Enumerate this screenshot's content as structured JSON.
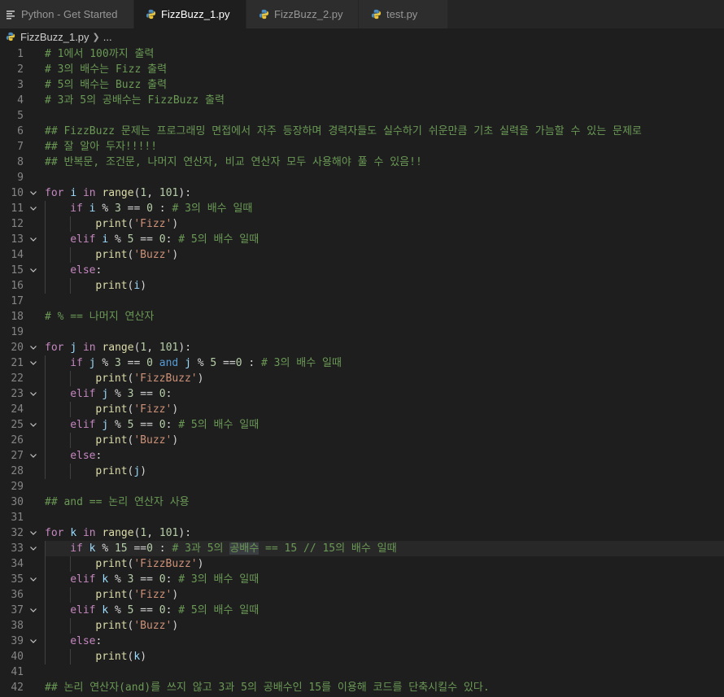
{
  "tabs": [
    {
      "label": "Python - Get Started",
      "icon": "preview-icon",
      "active": false,
      "modified": false
    },
    {
      "label": "FizzBuzz_1.py",
      "icon": "python-icon",
      "active": true,
      "modified": true
    },
    {
      "label": "FizzBuzz_2.py",
      "icon": "python-icon",
      "active": false,
      "modified": false
    },
    {
      "label": "test.py",
      "icon": "python-icon",
      "active": false,
      "modified": false
    }
  ],
  "breadcrumb": {
    "file": "FizzBuzz_1.py",
    "more": "..."
  },
  "colors": {
    "comment": "#6a9955",
    "keyword": "#c586c0",
    "operator_keyword": "#569cd6",
    "function": "#dcdcaa",
    "number": "#b5cea8",
    "string": "#ce9178",
    "variable": "#9cdcfe",
    "text": "#d4d4d4",
    "background": "#1e1e1e"
  },
  "current_line": 33,
  "lines": [
    {
      "n": "1",
      "indent": 0,
      "fold": false,
      "tokens": [
        [
          "c",
          "# 1에서 100까지 출력"
        ]
      ]
    },
    {
      "n": "2",
      "indent": 0,
      "fold": false,
      "tokens": [
        [
          "c",
          "# 3의 배수는 Fizz 출력"
        ]
      ]
    },
    {
      "n": "3",
      "indent": 0,
      "fold": false,
      "tokens": [
        [
          "c",
          "# 5의 배수는 Buzz 출력"
        ]
      ]
    },
    {
      "n": "4",
      "indent": 0,
      "fold": false,
      "tokens": [
        [
          "c",
          "# 3과 5의 공배수는 FizzBuzz 출력"
        ]
      ]
    },
    {
      "n": "5",
      "indent": 0,
      "fold": false,
      "tokens": []
    },
    {
      "n": "6",
      "indent": 0,
      "fold": false,
      "tokens": [
        [
          "c",
          "## FizzBuzz 문제는 프로그래밍 면접에서 자주 등장하며 경력자들도 실수하기 쉬운만큼 기초 실력을 가늠할 수 있는 문제로"
        ]
      ]
    },
    {
      "n": "7",
      "indent": 0,
      "fold": false,
      "tokens": [
        [
          "c",
          "## 잘 알아 두자!!!!!"
        ]
      ]
    },
    {
      "n": "8",
      "indent": 0,
      "fold": false,
      "tokens": [
        [
          "c",
          "## 반복문, 조건문, 나머지 연산자, 비교 연산자 모두 사용해야 풀 수 있음!!"
        ]
      ]
    },
    {
      "n": "9",
      "indent": 0,
      "fold": false,
      "tokens": []
    },
    {
      "n": "10",
      "indent": 0,
      "fold": true,
      "tokens": [
        [
          "k",
          "for"
        ],
        [
          "p",
          " "
        ],
        [
          "v",
          "i"
        ],
        [
          "p",
          " "
        ],
        [
          "k",
          "in"
        ],
        [
          "p",
          " "
        ],
        [
          "f",
          "range"
        ],
        [
          "p",
          "("
        ],
        [
          "n",
          "1"
        ],
        [
          "p",
          ", "
        ],
        [
          "n",
          "101"
        ],
        [
          "p",
          "):"
        ]
      ]
    },
    {
      "n": "11",
      "indent": 1,
      "fold": true,
      "tokens": [
        [
          "k",
          "if"
        ],
        [
          "p",
          " "
        ],
        [
          "v",
          "i"
        ],
        [
          "p",
          " % "
        ],
        [
          "n",
          "3"
        ],
        [
          "p",
          " == "
        ],
        [
          "n",
          "0"
        ],
        [
          "p",
          " : "
        ],
        [
          "c",
          "# 3의 배수 일때"
        ]
      ]
    },
    {
      "n": "12",
      "indent": 2,
      "fold": false,
      "tokens": [
        [
          "f",
          "print"
        ],
        [
          "p",
          "("
        ],
        [
          "s",
          "'Fizz'"
        ],
        [
          "p",
          ")"
        ]
      ]
    },
    {
      "n": "13",
      "indent": 1,
      "fold": true,
      "tokens": [
        [
          "k",
          "elif"
        ],
        [
          "p",
          " "
        ],
        [
          "v",
          "i"
        ],
        [
          "p",
          " % "
        ],
        [
          "n",
          "5"
        ],
        [
          "p",
          " == "
        ],
        [
          "n",
          "0"
        ],
        [
          "p",
          ": "
        ],
        [
          "c",
          "# 5의 배수 일때"
        ]
      ]
    },
    {
      "n": "14",
      "indent": 2,
      "fold": false,
      "tokens": [
        [
          "f",
          "print"
        ],
        [
          "p",
          "("
        ],
        [
          "s",
          "'Buzz'"
        ],
        [
          "p",
          ")"
        ]
      ]
    },
    {
      "n": "15",
      "indent": 1,
      "fold": true,
      "tokens": [
        [
          "k",
          "else"
        ],
        [
          "p",
          ":"
        ]
      ]
    },
    {
      "n": "16",
      "indent": 2,
      "fold": false,
      "tokens": [
        [
          "f",
          "print"
        ],
        [
          "p",
          "("
        ],
        [
          "v",
          "i"
        ],
        [
          "p",
          ")"
        ]
      ]
    },
    {
      "n": "17",
      "indent": 0,
      "fold": false,
      "tokens": []
    },
    {
      "n": "18",
      "indent": 0,
      "fold": false,
      "tokens": [
        [
          "c",
          "# % == 나머지 연산자"
        ]
      ]
    },
    {
      "n": "19",
      "indent": 0,
      "fold": false,
      "tokens": []
    },
    {
      "n": "20",
      "indent": 0,
      "fold": true,
      "tokens": [
        [
          "k",
          "for"
        ],
        [
          "p",
          " "
        ],
        [
          "v",
          "j"
        ],
        [
          "p",
          " "
        ],
        [
          "k",
          "in"
        ],
        [
          "p",
          " "
        ],
        [
          "f",
          "range"
        ],
        [
          "p",
          "("
        ],
        [
          "n",
          "1"
        ],
        [
          "p",
          ", "
        ],
        [
          "n",
          "101"
        ],
        [
          "p",
          "):"
        ]
      ]
    },
    {
      "n": "21",
      "indent": 1,
      "fold": true,
      "tokens": [
        [
          "k",
          "if"
        ],
        [
          "p",
          " "
        ],
        [
          "v",
          "j"
        ],
        [
          "p",
          " % "
        ],
        [
          "n",
          "3"
        ],
        [
          "p",
          " == "
        ],
        [
          "n",
          "0"
        ],
        [
          "p",
          " "
        ],
        [
          "kb",
          "and"
        ],
        [
          "p",
          " "
        ],
        [
          "v",
          "j"
        ],
        [
          "p",
          " % "
        ],
        [
          "n",
          "5"
        ],
        [
          "p",
          " =="
        ],
        [
          "n",
          "0"
        ],
        [
          "p",
          " : "
        ],
        [
          "c",
          "# 3의 배수 일때"
        ]
      ]
    },
    {
      "n": "22",
      "indent": 2,
      "fold": false,
      "tokens": [
        [
          "f",
          "print"
        ],
        [
          "p",
          "("
        ],
        [
          "s",
          "'FizzBuzz'"
        ],
        [
          "p",
          ")"
        ]
      ]
    },
    {
      "n": "23",
      "indent": 1,
      "fold": true,
      "tokens": [
        [
          "k",
          "elif"
        ],
        [
          "p",
          " "
        ],
        [
          "v",
          "j"
        ],
        [
          "p",
          " % "
        ],
        [
          "n",
          "3"
        ],
        [
          "p",
          " == "
        ],
        [
          "n",
          "0"
        ],
        [
          "p",
          ":"
        ]
      ]
    },
    {
      "n": "24",
      "indent": 2,
      "fold": false,
      "tokens": [
        [
          "f",
          "print"
        ],
        [
          "p",
          "("
        ],
        [
          "s",
          "'Fizz'"
        ],
        [
          "p",
          ")"
        ]
      ]
    },
    {
      "n": "25",
      "indent": 1,
      "fold": true,
      "tokens": [
        [
          "k",
          "elif"
        ],
        [
          "p",
          " "
        ],
        [
          "v",
          "j"
        ],
        [
          "p",
          " % "
        ],
        [
          "n",
          "5"
        ],
        [
          "p",
          " == "
        ],
        [
          "n",
          "0"
        ],
        [
          "p",
          ": "
        ],
        [
          "c",
          "# 5의 배수 일때"
        ]
      ]
    },
    {
      "n": "26",
      "indent": 2,
      "fold": false,
      "tokens": [
        [
          "f",
          "print"
        ],
        [
          "p",
          "("
        ],
        [
          "s",
          "'Buzz'"
        ],
        [
          "p",
          ")"
        ]
      ]
    },
    {
      "n": "27",
      "indent": 1,
      "fold": true,
      "tokens": [
        [
          "k",
          "else"
        ],
        [
          "p",
          ":"
        ]
      ]
    },
    {
      "n": "28",
      "indent": 2,
      "fold": false,
      "tokens": [
        [
          "f",
          "print"
        ],
        [
          "p",
          "("
        ],
        [
          "v",
          "j"
        ],
        [
          "p",
          ")"
        ]
      ]
    },
    {
      "n": "29",
      "indent": 0,
      "fold": false,
      "tokens": []
    },
    {
      "n": "30",
      "indent": 0,
      "fold": false,
      "tokens": [
        [
          "c",
          "## and == 논리 연산자 사용"
        ]
      ]
    },
    {
      "n": "31",
      "indent": 0,
      "fold": false,
      "tokens": []
    },
    {
      "n": "32",
      "indent": 0,
      "fold": true,
      "tokens": [
        [
          "k",
          "for"
        ],
        [
          "p",
          " "
        ],
        [
          "v",
          "k"
        ],
        [
          "p",
          " "
        ],
        [
          "k",
          "in"
        ],
        [
          "p",
          " "
        ],
        [
          "f",
          "range"
        ],
        [
          "p",
          "("
        ],
        [
          "n",
          "1"
        ],
        [
          "p",
          ", "
        ],
        [
          "n",
          "101"
        ],
        [
          "p",
          "):"
        ]
      ]
    },
    {
      "n": "33",
      "indent": 1,
      "fold": true,
      "tokens": [
        [
          "k",
          "if"
        ],
        [
          "p",
          " "
        ],
        [
          "v",
          "k"
        ],
        [
          "p",
          " % "
        ],
        [
          "n",
          "15"
        ],
        [
          "p",
          " =="
        ],
        [
          "n",
          "0"
        ],
        [
          "p",
          " : "
        ],
        [
          "c",
          "# 3과 5의 "
        ],
        [
          "csel",
          "공배수"
        ],
        [
          "c",
          " == 15 // 15의 배수 일때"
        ]
      ]
    },
    {
      "n": "34",
      "indent": 2,
      "fold": false,
      "tokens": [
        [
          "f",
          "print"
        ],
        [
          "p",
          "("
        ],
        [
          "s",
          "'FizzBuzz'"
        ],
        [
          "p",
          ")"
        ]
      ]
    },
    {
      "n": "35",
      "indent": 1,
      "fold": true,
      "tokens": [
        [
          "k",
          "elif"
        ],
        [
          "p",
          " "
        ],
        [
          "v",
          "k"
        ],
        [
          "p",
          " % "
        ],
        [
          "n",
          "3"
        ],
        [
          "p",
          " == "
        ],
        [
          "n",
          "0"
        ],
        [
          "p",
          ": "
        ],
        [
          "c",
          "# 3의 배수 일때"
        ]
      ]
    },
    {
      "n": "36",
      "indent": 2,
      "fold": false,
      "tokens": [
        [
          "f",
          "print"
        ],
        [
          "p",
          "("
        ],
        [
          "s",
          "'Fizz'"
        ],
        [
          "p",
          ")"
        ]
      ]
    },
    {
      "n": "37",
      "indent": 1,
      "fold": true,
      "tokens": [
        [
          "k",
          "elif"
        ],
        [
          "p",
          " "
        ],
        [
          "v",
          "k"
        ],
        [
          "p",
          " % "
        ],
        [
          "n",
          "5"
        ],
        [
          "p",
          " == "
        ],
        [
          "n",
          "0"
        ],
        [
          "p",
          ": "
        ],
        [
          "c",
          "# 5의 배수 일때"
        ]
      ]
    },
    {
      "n": "38",
      "indent": 2,
      "fold": false,
      "tokens": [
        [
          "f",
          "print"
        ],
        [
          "p",
          "("
        ],
        [
          "s",
          "'Buzz'"
        ],
        [
          "p",
          ")"
        ]
      ]
    },
    {
      "n": "39",
      "indent": 1,
      "fold": true,
      "tokens": [
        [
          "k",
          "else"
        ],
        [
          "p",
          ":"
        ]
      ]
    },
    {
      "n": "40",
      "indent": 2,
      "fold": false,
      "tokens": [
        [
          "f",
          "print"
        ],
        [
          "p",
          "("
        ],
        [
          "v",
          "k"
        ],
        [
          "p",
          ")"
        ]
      ]
    },
    {
      "n": "41",
      "indent": 0,
      "fold": false,
      "tokens": []
    },
    {
      "n": "42",
      "indent": 0,
      "fold": false,
      "tokens": [
        [
          "c",
          "## 논리 연산자(and)를 쓰지 않고 3과 5의 공배수인 15를 이용해 코드를 단축시킬수 있다."
        ]
      ]
    }
  ]
}
